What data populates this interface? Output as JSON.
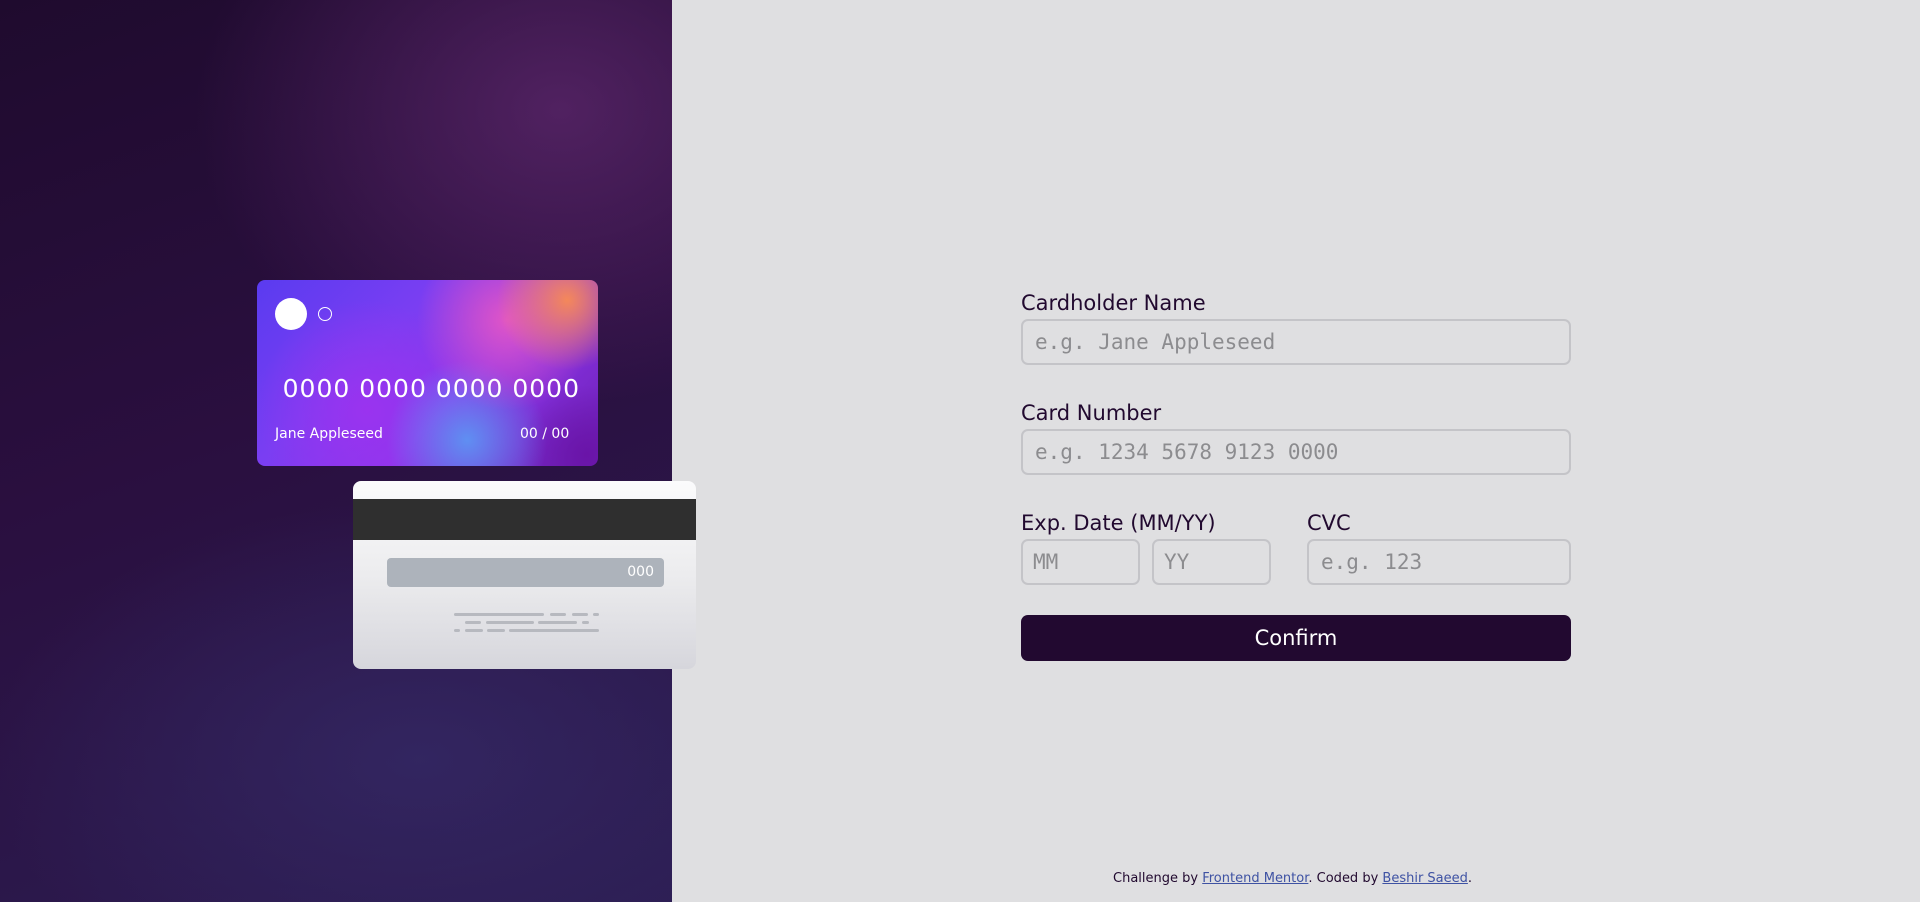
{
  "card_front": {
    "number": "0000 0000 0000 0000",
    "holder_name": "Jane Appleseed",
    "expiry": "00 / 00"
  },
  "card_back": {
    "cvc": "000"
  },
  "form": {
    "name_label": "Cardholder Name",
    "name_placeholder": "e.g. Jane Appleseed",
    "number_label": "Card Number",
    "number_placeholder": "e.g. 1234 5678 9123 0000",
    "exp_label": "Exp. Date (MM/YY)",
    "month_placeholder": "MM",
    "year_placeholder": "YY",
    "cvc_label": "CVC",
    "cvc_placeholder": "e.g. 123",
    "confirm_label": "Confirm"
  },
  "footer": {
    "prefix": "Challenge by ",
    "challenge_link": "Frontend Mentor",
    "middle": ". Coded by ",
    "author_link": "Beshir Saeed",
    "suffix": "."
  },
  "colors": {
    "dark_purple": "#220930",
    "page_background": "#dfdfe1",
    "input_border": "#c4c4c8",
    "link": "#3e52a3"
  }
}
